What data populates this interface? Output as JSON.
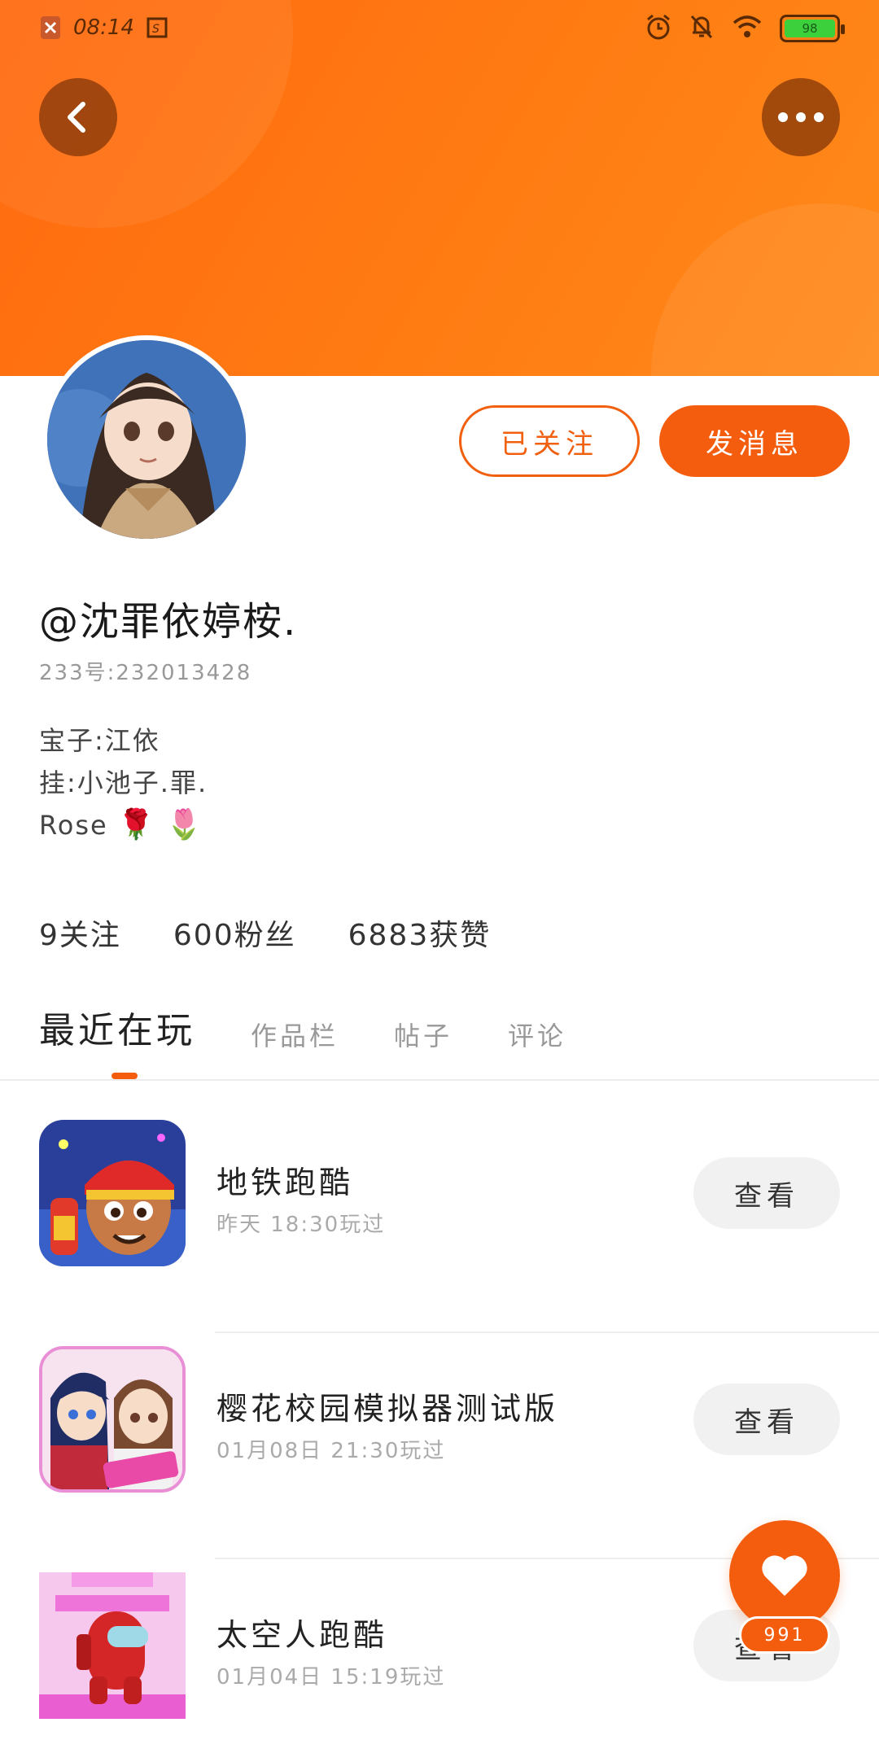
{
  "status_bar": {
    "time": "08:14",
    "battery_level": "98"
  },
  "actions": {
    "follow_label": "已关注",
    "message_label": "发消息"
  },
  "profile": {
    "username": "@沈罪依婷桉.",
    "user_id": "233号:232013428",
    "bio_line1": "宝子:江依",
    "bio_line2": "挂:小池子.罪.",
    "bio_line3": "Rose",
    "bio_emoji1": "🌹",
    "bio_emoji2": "🌷"
  },
  "stats": {
    "following": "9关注",
    "followers": "600粉丝",
    "likes": "6883获赞"
  },
  "tabs": [
    {
      "label": "最近在玩"
    },
    {
      "label": "作品栏"
    },
    {
      "label": "帖子"
    },
    {
      "label": "评论"
    }
  ],
  "games": [
    {
      "name": "地铁跑酷",
      "time": "昨天 18:30玩过",
      "button": "查看"
    },
    {
      "name": "樱花校园模拟器测试版",
      "time": "01月08日 21:30玩过",
      "button": "查看"
    },
    {
      "name": "太空人跑酷",
      "time": "01月04日 15:19玩过",
      "button": "查看"
    }
  ],
  "fab": {
    "count": "991"
  },
  "colors": {
    "accent": "#f45d0e",
    "header": "#ff7a12"
  }
}
